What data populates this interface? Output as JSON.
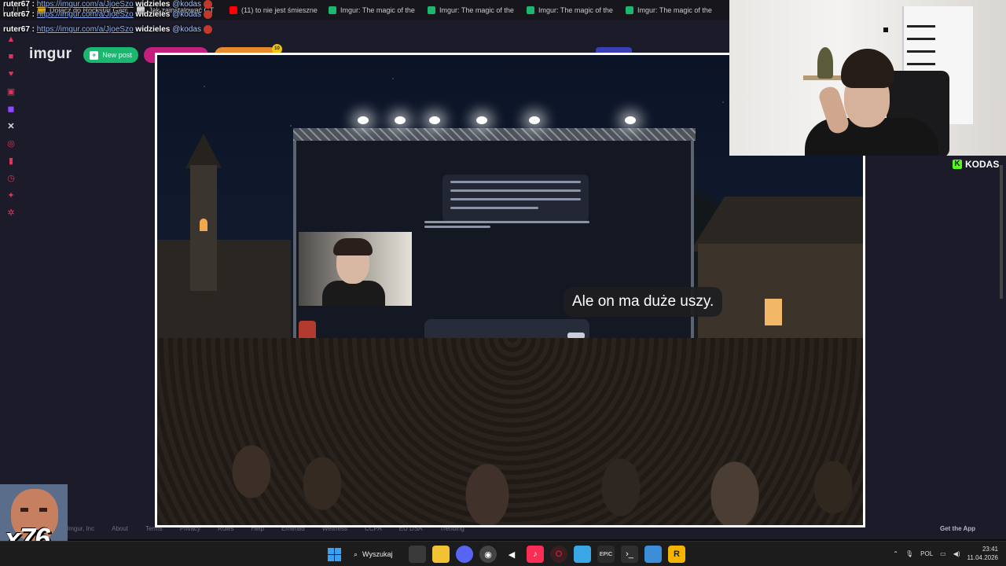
{
  "browser": {
    "tabs": [
      {
        "label": "Dołącz do Rockstar Gam",
        "icon_color": "#f4b400"
      },
      {
        "label": "Jak zainstalować GT",
        "icon_color": "#d9d9d9"
      },
      {
        "label": "(11) to nie jest śmieszne",
        "icon_color": "#ff0000"
      },
      {
        "label": "Imgur: The magic of the",
        "icon_color": "#1bb76e"
      },
      {
        "label": "Imgur: The magic of the",
        "icon_color": "#1bb76e"
      },
      {
        "label": "Imgur: The magic of the",
        "icon_color": "#1bb76e"
      },
      {
        "label": "Imgur: The magic of the",
        "icon_color": "#1bb76e"
      }
    ]
  },
  "chat": {
    "lines": [
      {
        "user": "ruter67 :",
        "link": "https://imgur.com/a/JjoeSzo",
        "word": "widzieles",
        "tag": "@kodas"
      },
      {
        "user": "ruter67 :",
        "link": "https://imgur.com/a/JjoeSzo",
        "word": "widzieles",
        "tag": "@kodas"
      },
      {
        "user": "ruter67 :",
        "link": "https://imgur.com/a/JjoeSzo",
        "word": "widzieles",
        "tag": "@kodas"
      }
    ]
  },
  "imgur": {
    "logo": "imgur",
    "new_post": "New post",
    "badge": "10",
    "footer": [
      "Imgur, Inc",
      "About",
      "Terms",
      "Privacy",
      "Rules",
      "Help",
      "Emerald",
      "Wellness",
      "CCPA",
      "EU DSA",
      "Trending"
    ],
    "get_app": "Get the App",
    "sidebar_icons": [
      "flame-icon",
      "bag-icon",
      "heart-icon",
      "image-icon",
      "twitch-icon",
      "x-icon",
      "gear-icon",
      "bookmark-icon",
      "clock-icon",
      "star-icon",
      "settings-icon"
    ]
  },
  "video": {
    "caption": "Ale on ma duże uszy."
  },
  "streamer": {
    "brand": "KODAS"
  },
  "overlay": {
    "multiplier": "x76"
  },
  "taskbar": {
    "search_label": "Wyszukaj",
    "language": "POL",
    "time": "23:41",
    "date": "11.04.2026",
    "app_icons": [
      "file-explorer-icon",
      "discord-icon",
      "steam-icon",
      "capcut-icon",
      "music-icon",
      "opera-icon",
      "notepad-icon",
      "epic-games-icon",
      "terminal-icon",
      "photos-icon",
      "rockstar-icon"
    ]
  }
}
